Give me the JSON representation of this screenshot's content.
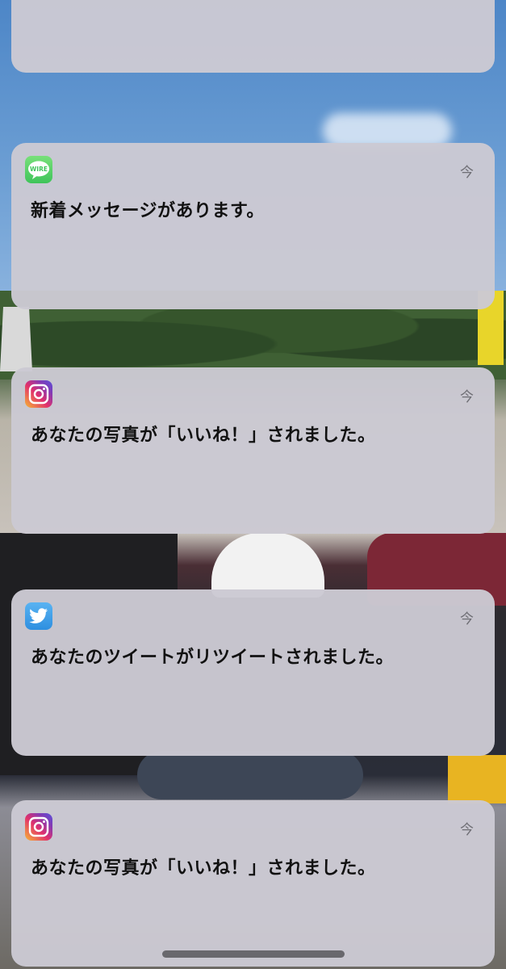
{
  "notifications": [
    {
      "app_icon": "wire-chat-icon",
      "icon_label": "WIRE",
      "time": "今",
      "message": "新着メッセージがあります。"
    },
    {
      "app_icon": "camera-app-icon",
      "time": "今",
      "message": "あなたの写真が「いいね！」されました。"
    },
    {
      "app_icon": "bird-app-icon",
      "time": "今",
      "message": "あなたのツイートがリツイートされました。"
    },
    {
      "app_icon": "camera-app-icon",
      "time": "今",
      "message": "あなたの写真が「いいね！」されました。"
    }
  ],
  "colors": {
    "card_background": "#cbc9d3",
    "message_text": "#111111",
    "time_text": "#6e6e74"
  }
}
